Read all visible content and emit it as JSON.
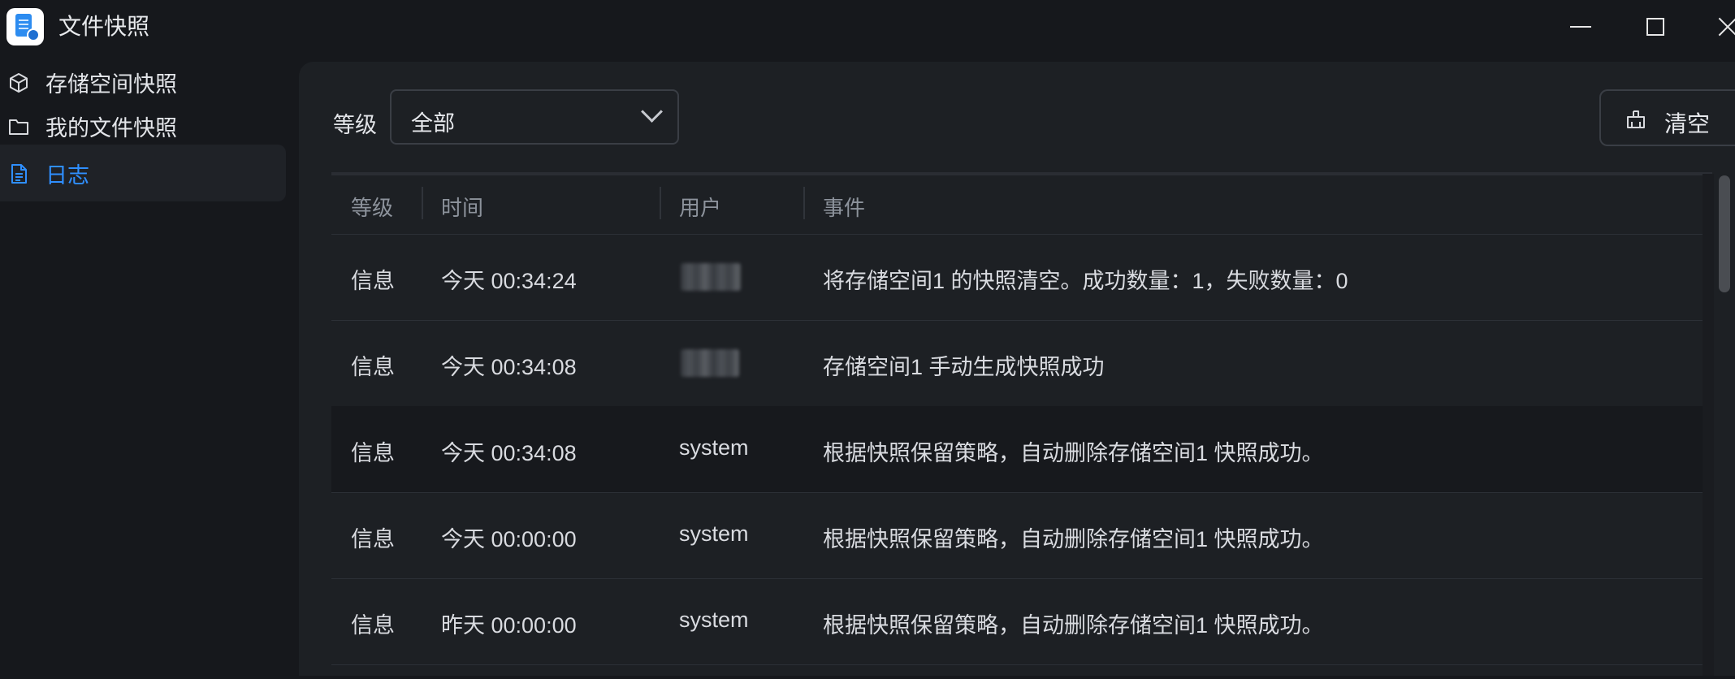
{
  "window": {
    "title": "文件快照",
    "controls": {
      "minimize": "minimize-icon",
      "maximize": "maximize-icon",
      "close": "close-icon"
    }
  },
  "sidebar": {
    "items": [
      {
        "label": "存储空间快照",
        "icon": "cube-icon",
        "active": false
      },
      {
        "label": "我的文件快照",
        "icon": "folder-icon",
        "active": false
      },
      {
        "label": "日志",
        "icon": "document-icon",
        "active": true
      }
    ]
  },
  "filter": {
    "label": "等级",
    "selected": "全部"
  },
  "toolbar": {
    "clear_label": "清空",
    "clear_icon": "broom-icon"
  },
  "table": {
    "columns": [
      "等级",
      "时间",
      "用户",
      "事件"
    ],
    "rows": [
      {
        "level": "信息",
        "time": "今天 00:34:24",
        "user": "",
        "event": "将存储空间1 的快照清空。成功数量：1，失败数量：0"
      },
      {
        "level": "信息",
        "time": "今天 00:34:08",
        "user": "",
        "event": "存储空间1 手动生成快照成功"
      },
      {
        "level": "信息",
        "time": "今天 00:34:08",
        "user": "system",
        "event": "根据快照保留策略，自动删除存储空间1 快照成功。"
      },
      {
        "level": "信息",
        "time": "今天 00:00:00",
        "user": "system",
        "event": "根据快照保留策略，自动删除存储空间1 快照成功。"
      },
      {
        "level": "信息",
        "time": "昨天 00:00:00",
        "user": "system",
        "event": "根据快照保留策略，自动删除存储空间1 快照成功。"
      }
    ]
  },
  "colors": {
    "accent": "#2f8fff",
    "background": "#16181c",
    "panel": "#1d2024"
  }
}
